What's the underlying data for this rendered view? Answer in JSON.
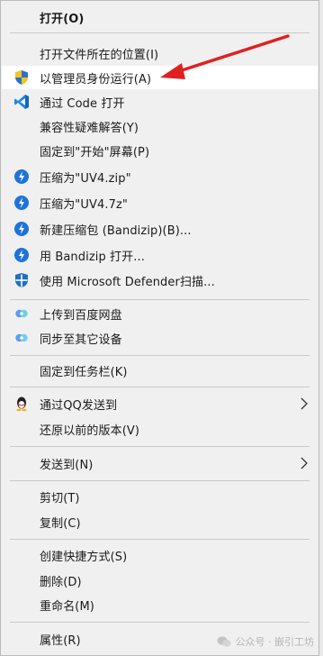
{
  "menu": {
    "items": [
      {
        "label": "打开(O)",
        "icon": "",
        "bold": true
      },
      {
        "label": "打开文件所在的位置(I)",
        "icon": ""
      },
      {
        "label": "以管理员身份运行(A)",
        "icon": "uac-shield-icon",
        "highlighted": true
      },
      {
        "label": "通过 Code 打开",
        "icon": "vscode-icon"
      },
      {
        "label": "兼容性疑难解答(Y)",
        "icon": ""
      },
      {
        "label": "固定到\"开始\"屏幕(P)",
        "icon": ""
      },
      {
        "label": "压缩为\"UV4.zip\"",
        "icon": "bandizip-icon"
      },
      {
        "label": "压缩为\"UV4.7z\"",
        "icon": "bandizip-icon"
      },
      {
        "label": "新建压缩包 (Bandizip)(B)...",
        "icon": "bandizip-icon"
      },
      {
        "label": "用 Bandizip 打开...",
        "icon": "bandizip-icon"
      },
      {
        "label": "使用 Microsoft Defender扫描...",
        "icon": "defender-icon"
      },
      {
        "label": "上传到百度网盘",
        "icon": "baidu-netdisk-icon"
      },
      {
        "label": "同步至其它设备",
        "icon": "baidu-netdisk-icon"
      },
      {
        "label": "固定到任务栏(K)",
        "icon": ""
      },
      {
        "label": "通过QQ发送到",
        "icon": "qq-penguin-icon",
        "submenu": true
      },
      {
        "label": "还原以前的版本(V)",
        "icon": ""
      },
      {
        "label": "发送到(N)",
        "icon": "",
        "submenu": true
      },
      {
        "label": "剪切(T)",
        "icon": ""
      },
      {
        "label": "复制(C)",
        "icon": ""
      },
      {
        "label": "创建快捷方式(S)",
        "icon": ""
      },
      {
        "label": "删除(D)",
        "icon": ""
      },
      {
        "label": "重命名(M)",
        "icon": ""
      },
      {
        "label": "属性(R)",
        "icon": ""
      }
    ]
  },
  "annotation": {
    "type": "red-arrow",
    "color": "#e02020",
    "points_to": "以管理员身份运行(A)"
  },
  "watermark": {
    "text": "公众号 · 嵌引工坊"
  },
  "colors": {
    "menu_bg": "#f0f0f0",
    "highlight_bg": "#ffffff",
    "separator": "#c9c9c9",
    "arrow": "#e02020"
  }
}
